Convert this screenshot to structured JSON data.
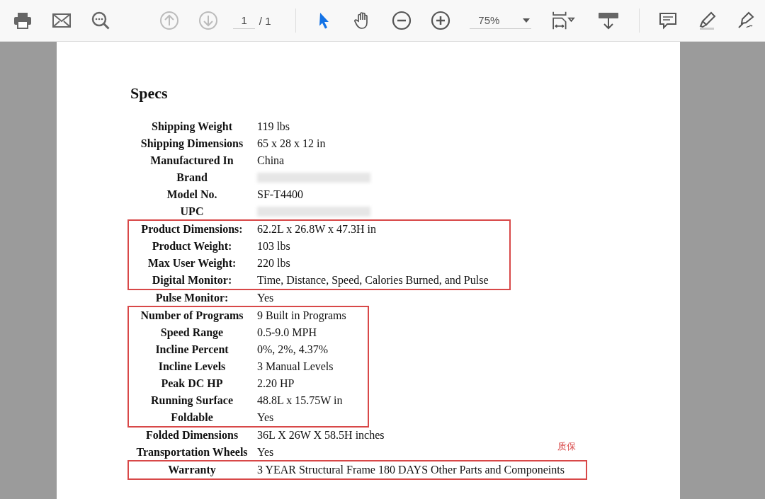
{
  "toolbar": {
    "page_number": "1",
    "page_total": "/ 1",
    "zoom": "75%",
    "tools": [
      {
        "kind": "select",
        "selected": true
      },
      {
        "kind": "hand",
        "selected": false
      }
    ],
    "nav": [
      {
        "kind": "up",
        "disabled": true
      },
      {
        "kind": "down",
        "disabled": true
      }
    ]
  },
  "document": {
    "heading": "Specs",
    "groups": [
      {
        "boxed": false,
        "rows": [
          {
            "label": "Shipping Weight",
            "value": "119 lbs"
          },
          {
            "label": "Shipping Dimensions",
            "value": "65 x 28 x 12 in"
          },
          {
            "label": "Manufactured In",
            "value": "China"
          },
          {
            "label": "Brand",
            "redacted": true
          },
          {
            "label": "Model No.",
            "value": "SF-T4400"
          },
          {
            "label": "UPC",
            "redacted": true
          }
        ]
      },
      {
        "boxed": true,
        "rows": [
          {
            "label": "Product Dimensions:",
            "value": "62.2L x 26.8W x 47.3H in"
          },
          {
            "label": "Product Weight:",
            "value": "103 lbs"
          },
          {
            "label": "Max User Weight:",
            "value": "220 lbs"
          },
          {
            "label": "Digital Monitor:",
            "value": "Time, Distance, Speed, Calories Burned, and Pulse"
          }
        ]
      },
      {
        "boxed": false,
        "rows": [
          {
            "label": "Pulse Monitor:",
            "value": "Yes"
          }
        ]
      },
      {
        "boxed": true,
        "rows": [
          {
            "label": "Number of Programs",
            "value": "9 Built in Programs"
          },
          {
            "label": "Speed Range",
            "value": "0.5-9.0 MPH"
          },
          {
            "label": "Incline Percent",
            "value": "0%, 2%, 4.37%"
          },
          {
            "label": "Incline Levels",
            "value": "3 Manual Levels"
          },
          {
            "label": "Peak DC HP",
            "value": "2.20 HP"
          },
          {
            "label": "Running Surface",
            "value": "48.8L x 15.75W in"
          },
          {
            "label": "Foldable",
            "value": "Yes"
          }
        ]
      },
      {
        "boxed": false,
        "rows": [
          {
            "label": "Folded Dimensions",
            "value": "36L X 26W X 58.5H inches"
          },
          {
            "label": "Transportation Wheels",
            "value": "Yes"
          }
        ]
      },
      {
        "boxed": true,
        "note": "质保",
        "rows": [
          {
            "label": "Warranty",
            "value": "3 YEAR Structural Frame 180 DAYS Other Parts and Componeints"
          }
        ]
      }
    ]
  }
}
